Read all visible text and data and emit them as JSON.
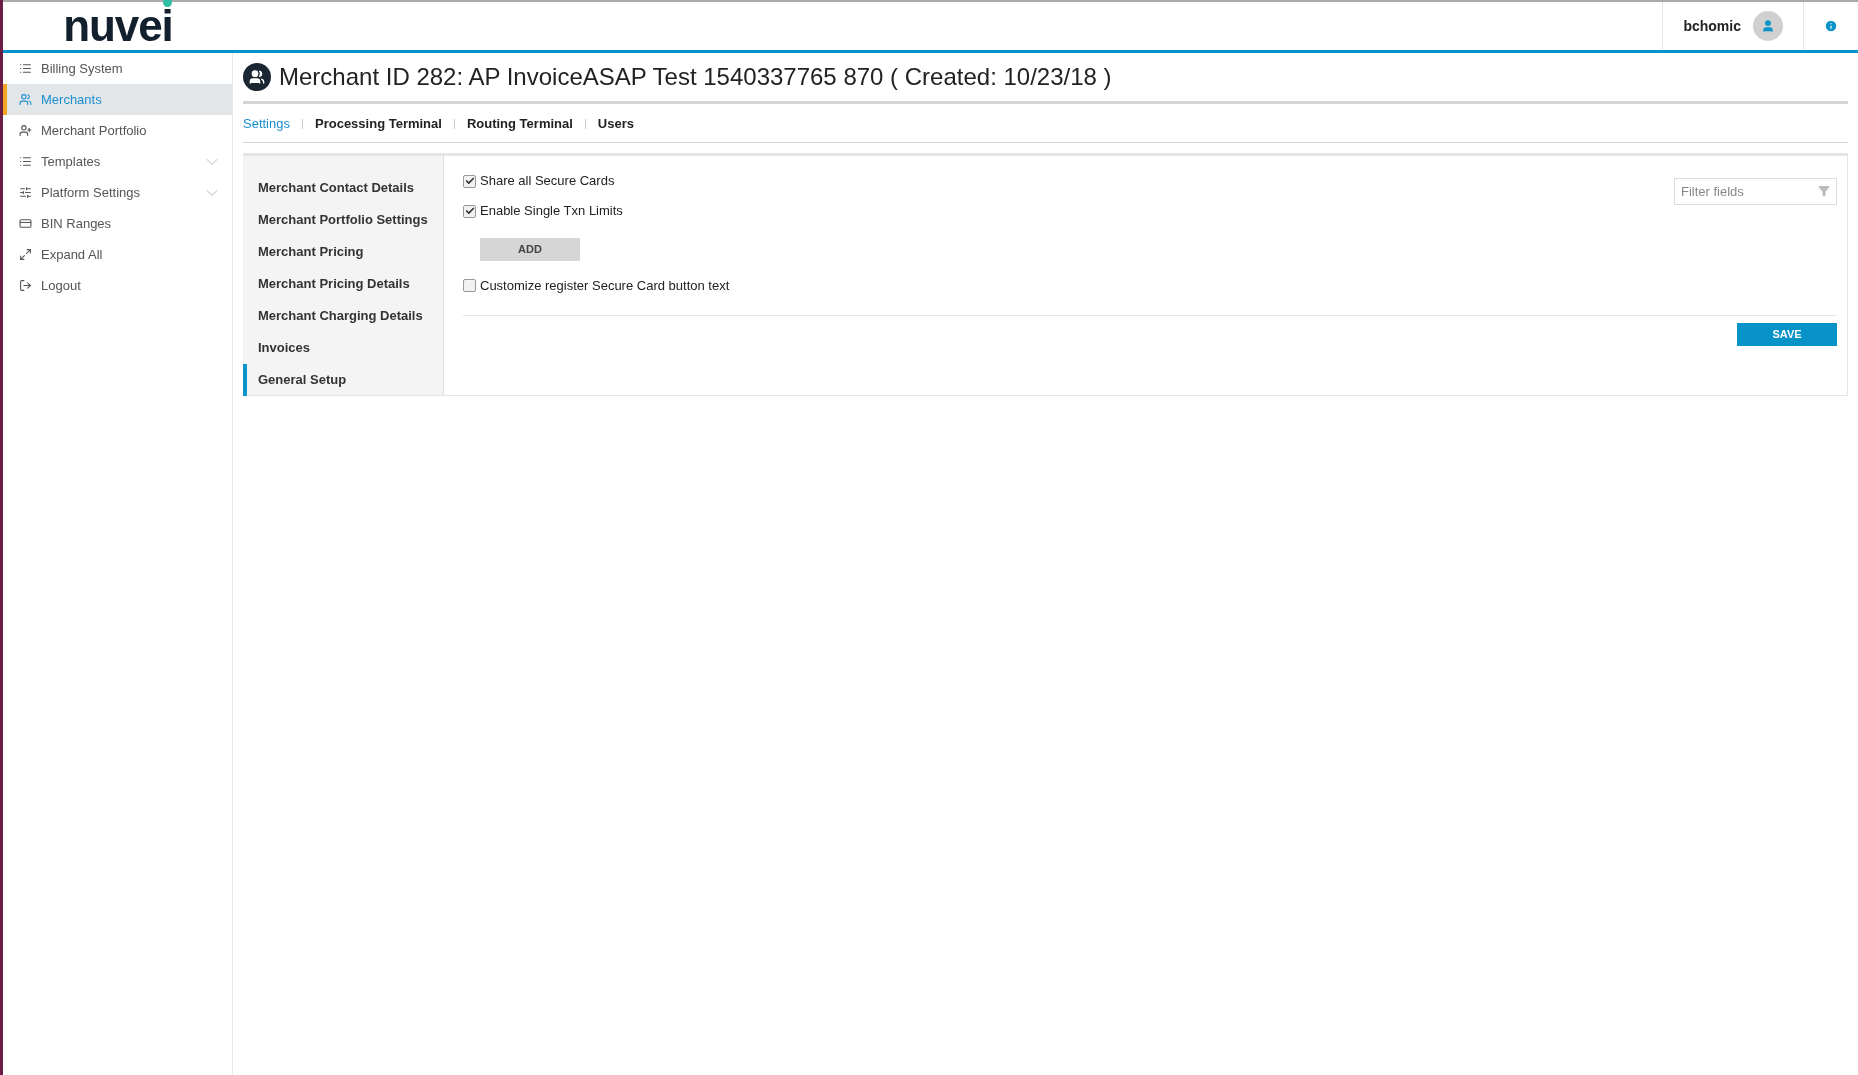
{
  "header": {
    "logo": "nuvei",
    "username": "bchomic"
  },
  "sidebar": {
    "items": [
      {
        "label": "Billing System",
        "selected": false,
        "expandable": false
      },
      {
        "label": "Merchants",
        "selected": true,
        "expandable": false
      },
      {
        "label": "Merchant Portfolio",
        "selected": false,
        "expandable": false
      },
      {
        "label": "Templates",
        "selected": false,
        "expandable": true
      },
      {
        "label": "Platform Settings",
        "selected": false,
        "expandable": true
      },
      {
        "label": "BIN Ranges",
        "selected": false,
        "expandable": false
      },
      {
        "label": "Expand All",
        "selected": false,
        "expandable": false
      },
      {
        "label": "Logout",
        "selected": false,
        "expandable": false
      }
    ]
  },
  "page_title": "Merchant ID 282: AP InvoiceASAP Test 1540337765 870 ( Created: 10/23/18 )",
  "tabs": [
    {
      "label": "Settings",
      "selected": true
    },
    {
      "label": "Processing Terminal",
      "selected": false
    },
    {
      "label": "Routing Terminal",
      "selected": false
    },
    {
      "label": "Users",
      "selected": false
    }
  ],
  "section_nav": [
    {
      "label": "Merchant Contact Details",
      "selected": false
    },
    {
      "label": "Merchant Portfolio Settings",
      "selected": false
    },
    {
      "label": "Merchant Pricing",
      "selected": false
    },
    {
      "label": "Merchant Pricing Details",
      "selected": false
    },
    {
      "label": "Merchant Charging Details",
      "selected": false
    },
    {
      "label": "Invoices",
      "selected": false
    },
    {
      "label": "General Setup",
      "selected": true
    }
  ],
  "settings": [
    {
      "kind": "checkbox",
      "label": "Share all Secure Cards",
      "checked": true
    },
    {
      "kind": "checkbox",
      "label": "Enable Single Txn Limits",
      "checked": true
    },
    {
      "kind": "button",
      "label": "ADD"
    },
    {
      "kind": "checkbox",
      "label": "Customize register Secure Card button text",
      "checked": false
    }
  ],
  "filter": {
    "placeholder": "Filter fields"
  },
  "save_button": "SAVE"
}
